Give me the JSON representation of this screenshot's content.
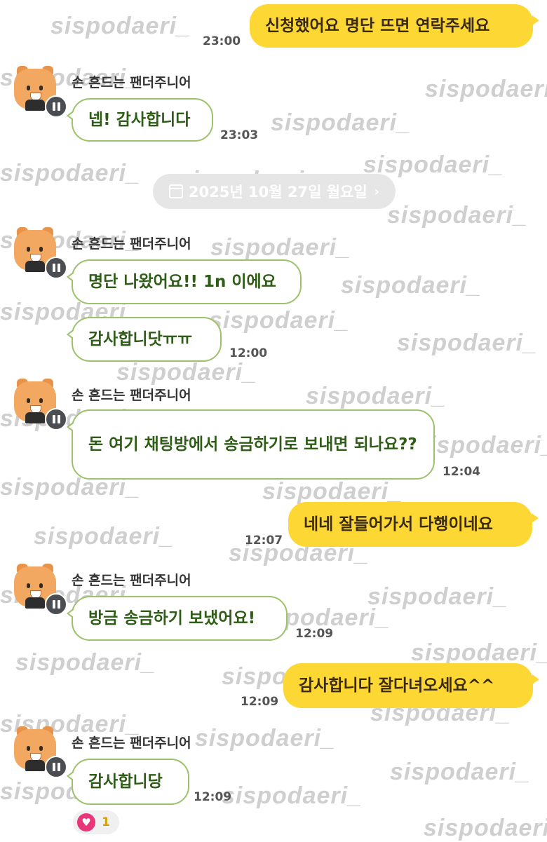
{
  "watermark": "sispodaeri_",
  "colors": {
    "bg": "#ffffff",
    "incoming_border": "#9cc26b",
    "incoming_text": "#2f5d18",
    "outgoing_bg": "#fdd835",
    "reaction_heart": "#e8367a"
  },
  "sender_name": "손 흔드는 팬더주니어",
  "date_divider": {
    "text": "2025년 10월 27일 월요일",
    "icon": "calendar-icon",
    "chevron": "›"
  },
  "messages": [
    {
      "text": "신청했어요 명단 뜨면 연락주세요",
      "time": "23:00"
    },
    {
      "text": "넵! 감사합니다",
      "time": "23:03"
    },
    {
      "text": "명단 나왔어요!! 1n 이에요"
    },
    {
      "text": "감사합니닷ㅠㅠ",
      "time": "12:00"
    },
    {
      "text": "돈 여기 채팅방에서 송금하기로 보내면 되나요??",
      "time": "12:04"
    },
    {
      "text": "네네 잘들어가서 다행이네요",
      "time": "12:07"
    },
    {
      "text": "방금 송금하기 보냈어요!",
      "time": "12:09"
    },
    {
      "text": "감사합니다 잘다녀오세요^^",
      "time": "12:09"
    },
    {
      "text": "감사합니당",
      "time": "12:09"
    }
  ],
  "reaction": {
    "icon": "heart-icon",
    "symbol": "♥",
    "count": "1"
  }
}
